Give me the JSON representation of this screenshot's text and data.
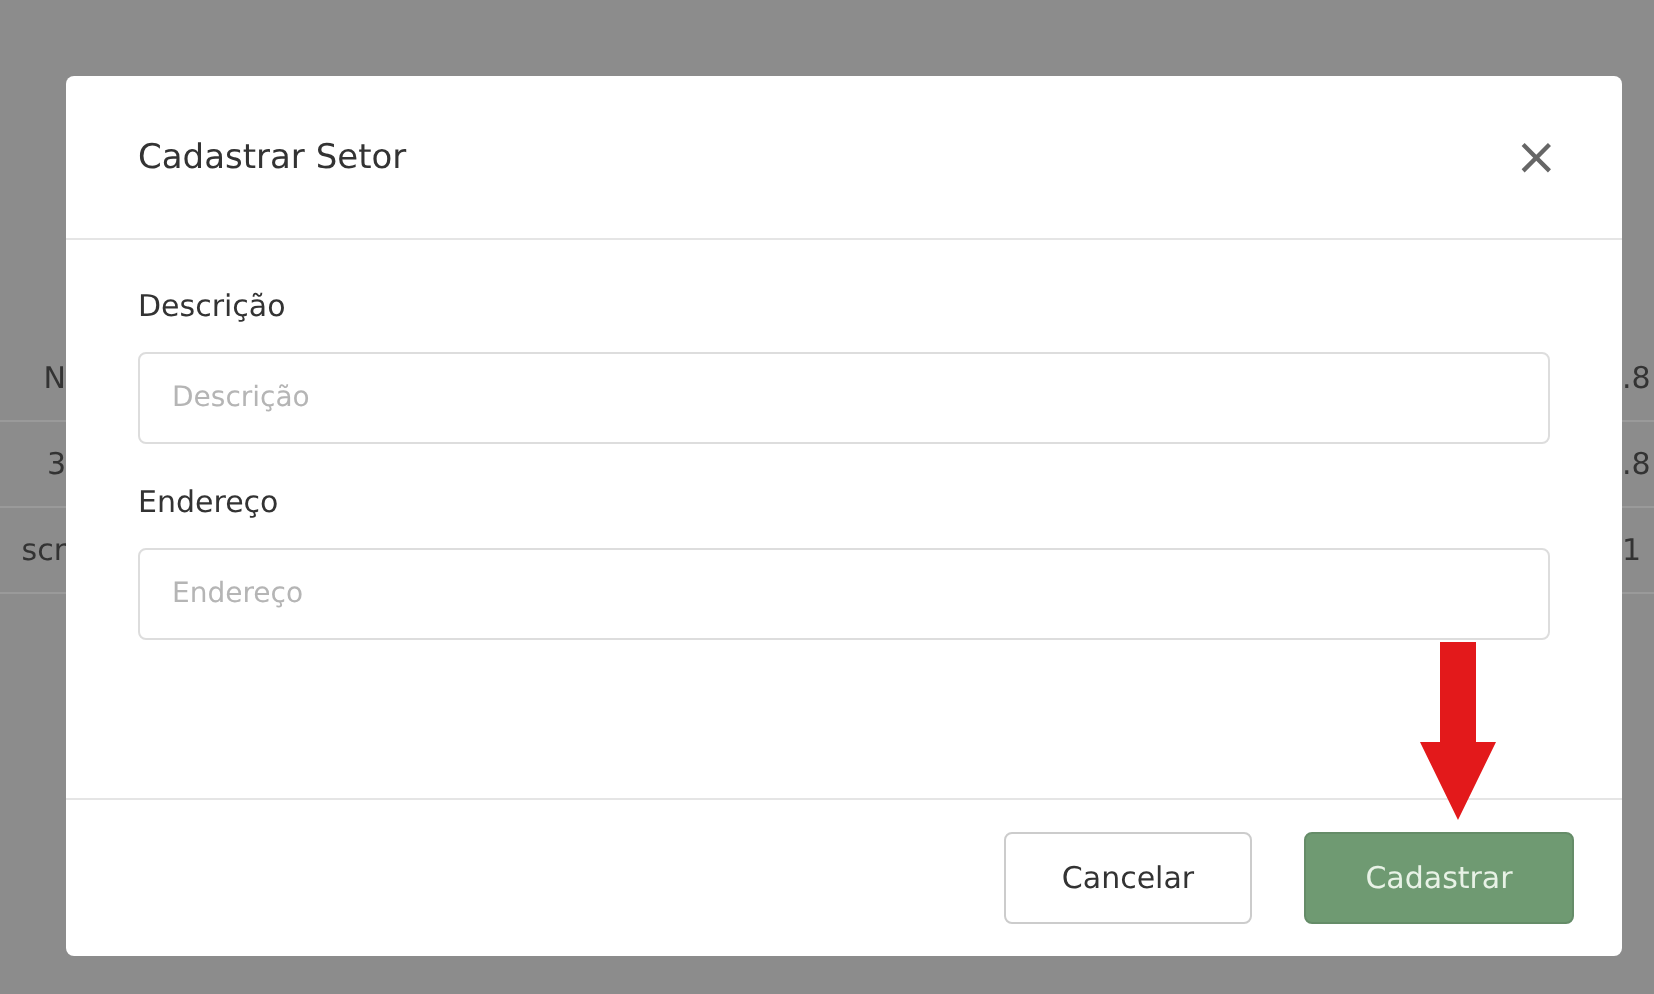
{
  "background_table": {
    "rows": [
      {
        "column_1": "N",
        "column_2": ".8"
      },
      {
        "column_1": "3",
        "column_2": ".8"
      },
      {
        "column_1": "scr",
        "column_2": "1"
      }
    ]
  },
  "modal": {
    "title": "Cadastrar Setor",
    "close": "×",
    "fields": [
      {
        "label": "Descrição",
        "placeholder": "Descrição"
      },
      {
        "label": "Endereço",
        "placeholder": "Endereço"
      }
    ],
    "buttons": [
      {
        "label": "Cancelar",
        "kind": "secondary"
      },
      {
        "label": "Cadastrar",
        "kind": "primary"
      }
    ]
  }
}
